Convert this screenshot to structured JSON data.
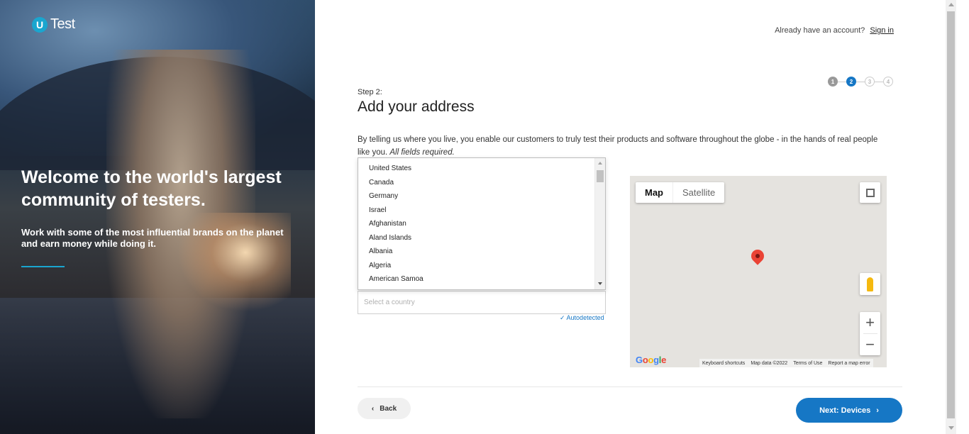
{
  "brand": {
    "logo_letter": "U",
    "logo_text": "Test",
    "accent": "#1aa6cf",
    "primary": "#1677c5"
  },
  "hero": {
    "headline": "Welcome to the world's largest community of testers.",
    "subtext": "Work with some of the most influential brands on the planet and earn money while doing it."
  },
  "header": {
    "account_prompt": "Already have an account?",
    "signin_label": "Sign in"
  },
  "steps": [
    {
      "label": "1",
      "state": "done"
    },
    {
      "label": "2",
      "state": "active"
    },
    {
      "label": "3",
      "state": "todo"
    },
    {
      "label": "4",
      "state": "todo"
    }
  ],
  "form": {
    "step_label": "Step 2:",
    "title": "Add your address",
    "intro": "By telling us where you live, you enable our customers to truly test their products and software throughout the globe - in the hands of real people like you.",
    "intro_note": "All fields required.",
    "country_placeholder": "Select a country",
    "autodetected": "✓ Autodetected"
  },
  "country_dropdown": {
    "options": [
      "United States",
      "Canada",
      "Germany",
      "Israel",
      "Afghanistan",
      "Aland Islands",
      "Albania",
      "Algeria",
      "American Samoa"
    ]
  },
  "map": {
    "tab_map": "Map",
    "tab_satellite": "Satellite",
    "zoom_in": "+",
    "zoom_out": "−",
    "footer": [
      "Keyboard shortcuts",
      "Map data ©2022",
      "Terms of Use",
      "Report a map error"
    ],
    "google_letters": [
      "G",
      "o",
      "o",
      "g",
      "l",
      "e"
    ]
  },
  "nav": {
    "back_label": "Back",
    "next_label": "Next: Devices"
  }
}
